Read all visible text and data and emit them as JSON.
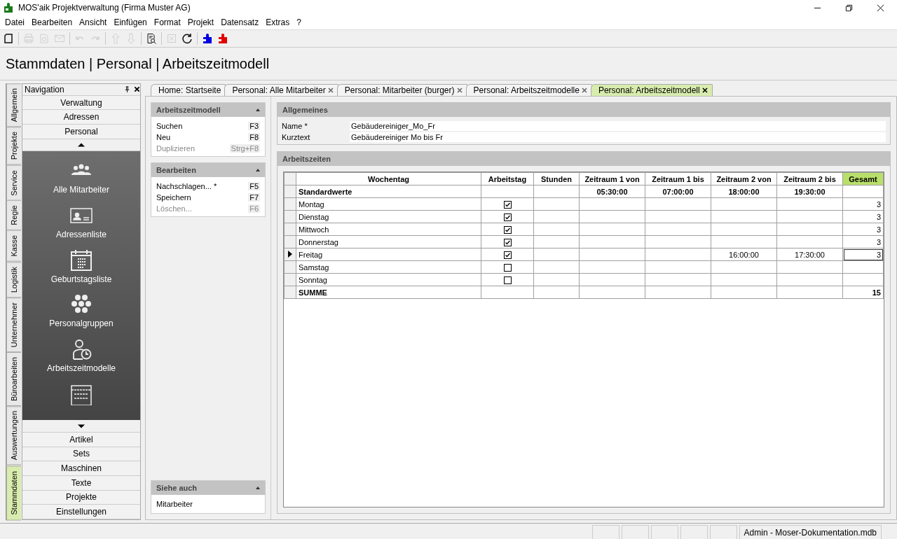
{
  "window": {
    "title": "MOS'aik Projektverwaltung (Firma Muster AG)"
  },
  "menu": [
    "Datei",
    "Bearbeiten",
    "Ansicht",
    "Einfügen",
    "Format",
    "Projekt",
    "Datensatz",
    "Extras",
    "?"
  ],
  "toolbar": [
    {
      "kind": "new",
      "disabled": false
    },
    {
      "kind": "sep"
    },
    {
      "kind": "print",
      "disabled": true
    },
    {
      "kind": "preview",
      "disabled": true
    },
    {
      "kind": "mail",
      "disabled": true
    },
    {
      "kind": "sep"
    },
    {
      "kind": "undo",
      "disabled": true
    },
    {
      "kind": "redo",
      "disabled": true
    },
    {
      "kind": "sep"
    },
    {
      "kind": "up",
      "disabled": true
    },
    {
      "kind": "down",
      "disabled": true
    },
    {
      "kind": "sep"
    },
    {
      "kind": "find",
      "disabled": false
    },
    {
      "kind": "sep"
    },
    {
      "kind": "excel",
      "disabled": true
    },
    {
      "kind": "refresh",
      "disabled": false
    },
    {
      "kind": "sep"
    },
    {
      "kind": "puzzle",
      "color": "#0000e0",
      "disabled": false
    },
    {
      "kind": "puzzle",
      "color": "#e00000",
      "disabled": false
    }
  ],
  "breadcrumb": "Stammdaten | Personal | Arbeitszeitmodell",
  "vertical_tabs": [
    {
      "label": "Allgemein",
      "selected": false
    },
    {
      "label": "Projekte",
      "selected": false
    },
    {
      "label": "Service",
      "selected": false
    },
    {
      "label": "Regie",
      "selected": false
    },
    {
      "label": "Kasse",
      "selected": false
    },
    {
      "label": "Logistik",
      "selected": false
    },
    {
      "label": "Unternehmer",
      "selected": false
    },
    {
      "label": "Büroarbeiten",
      "selected": false
    },
    {
      "label": "Auswertungen",
      "selected": false
    },
    {
      "label": "Stammdaten",
      "selected": true
    }
  ],
  "navigation": {
    "title": "Navigation",
    "groups_top": [
      {
        "label": "Verwaltung"
      },
      {
        "label": "Adressen"
      },
      {
        "label": "Personal"
      }
    ],
    "items": [
      {
        "kind": "people",
        "label": "Alle Mitarbeiter"
      },
      {
        "kind": "card",
        "label": "Adressenliste"
      },
      {
        "kind": "calendar",
        "label": "Geburtstagsliste"
      },
      {
        "kind": "hexagons",
        "label": "Personalgruppen"
      },
      {
        "kind": "person-clock",
        "label": "Arbeitszeitmodelle"
      },
      {
        "kind": "abacus"
      }
    ],
    "groups_bottom": [
      {
        "label": "Artikel"
      },
      {
        "label": "Sets"
      },
      {
        "label": "Maschinen"
      },
      {
        "label": "Texte"
      },
      {
        "label": "Projekte"
      },
      {
        "label": "Einstellungen"
      }
    ]
  },
  "doc_tabs": [
    {
      "label": "Home: Startseite",
      "closable": false,
      "selected": false
    },
    {
      "label": "Personal: Alle Mitarbeiter",
      "closable": true,
      "selected": false
    },
    {
      "label": "Personal: Mitarbeiter (burger)",
      "closable": true,
      "selected": false
    },
    {
      "label": "Personal: Arbeitszeitmodelle",
      "closable": true,
      "selected": false
    },
    {
      "label": "Personal: Arbeitszeitmodell",
      "closable": true,
      "selected": true
    }
  ],
  "task_panels": [
    {
      "title": "Arbeitszeitmodell",
      "items": [
        {
          "label": "Suchen",
          "shortcut": "F3",
          "disabled": false
        },
        {
          "label": "Neu",
          "shortcut": "F8",
          "disabled": false
        },
        {
          "label": "Duplizieren",
          "shortcut": "Strg+F8",
          "disabled": true
        }
      ]
    },
    {
      "title": "Bearbeiten",
      "items": [
        {
          "label": "Nachschlagen... *",
          "shortcut": "F5",
          "disabled": false
        },
        {
          "label": "Speichern",
          "shortcut": "F7",
          "disabled": false
        },
        {
          "label": "Löschen...",
          "shortcut": "F6",
          "disabled": true
        }
      ]
    }
  ],
  "see_also": {
    "title": "Siehe auch",
    "items": [
      "Mitarbeiter"
    ]
  },
  "general": {
    "title": "Allgemeines",
    "fields": [
      {
        "label": "Name *",
        "value": "Gebäudereiniger_Mo_Fr"
      },
      {
        "label": "Kurztext",
        "value": "Gebäudereiniger Mo bis Fr"
      }
    ]
  },
  "work_times": {
    "title": "Arbeitszeiten",
    "columns": [
      {
        "label": "Wochentag",
        "highlighted": false
      },
      {
        "label": "Arbeitstag",
        "highlighted": false
      },
      {
        "label": "Stunden",
        "highlighted": false
      },
      {
        "label": "Zeitraum 1 von",
        "highlighted": false
      },
      {
        "label": "Zeitraum 1 bis",
        "highlighted": false
      },
      {
        "label": "Zeitraum 2 von",
        "highlighted": false
      },
      {
        "label": "Zeitraum 2 bis",
        "highlighted": false
      },
      {
        "label": "Gesamt",
        "highlighted": true
      }
    ],
    "rows": [
      {
        "kind": "defaults",
        "current": false,
        "cells": [
          "Standardwerte",
          "",
          "",
          "05:30:00",
          "07:00:00",
          "18:00:00",
          "19:30:00",
          ""
        ]
      },
      {
        "kind": "day",
        "current": false,
        "checked": true,
        "cells": [
          "Montag",
          "",
          "",
          "",
          "",
          "",
          "",
          "3"
        ]
      },
      {
        "kind": "day",
        "current": false,
        "checked": true,
        "cells": [
          "Dienstag",
          "",
          "",
          "",
          "",
          "",
          "",
          "3"
        ]
      },
      {
        "kind": "day",
        "current": false,
        "checked": true,
        "cells": [
          "Mittwoch",
          "",
          "",
          "",
          "",
          "",
          "",
          "3"
        ]
      },
      {
        "kind": "day",
        "current": false,
        "checked": true,
        "cells": [
          "Donnerstag",
          "",
          "",
          "",
          "",
          "",
          "",
          "3"
        ]
      },
      {
        "kind": "day",
        "current": true,
        "checked": true,
        "cells": [
          "Freitag",
          "",
          "",
          "",
          "",
          "16:00:00",
          "17:30:00",
          "3"
        ]
      },
      {
        "kind": "day",
        "current": false,
        "checked": false,
        "cells": [
          "Samstag",
          "",
          "",
          "",
          "",
          "",
          "",
          ""
        ]
      },
      {
        "kind": "day",
        "current": false,
        "checked": false,
        "cells": [
          "Sonntag",
          "",
          "",
          "",
          "",
          "",
          "",
          ""
        ]
      },
      {
        "kind": "total",
        "current": false,
        "cells": [
          "SUMME",
          "",
          "",
          "",
          "",
          "",
          "",
          "15"
        ]
      }
    ]
  },
  "status_bar": {
    "text": "Admin - Moser-Dokumentation.mdb"
  }
}
